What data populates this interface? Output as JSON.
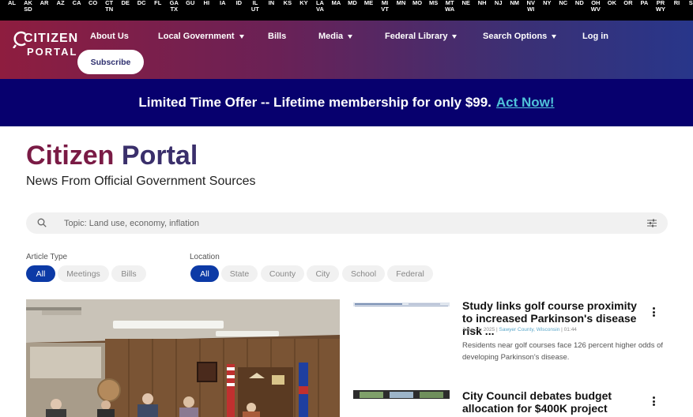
{
  "states": [
    {
      "top": "AL"
    },
    {
      "top": "AK",
      "bottom": "SD"
    },
    {
      "top": "AR"
    },
    {
      "top": "AZ"
    },
    {
      "top": "CA"
    },
    {
      "top": "CO"
    },
    {
      "top": "CT",
      "bottom": "TN"
    },
    {
      "top": "DE"
    },
    {
      "top": "DC"
    },
    {
      "top": "FL"
    },
    {
      "top": "GA",
      "bottom": "TX"
    },
    {
      "top": "GU"
    },
    {
      "top": "HI"
    },
    {
      "top": "IA"
    },
    {
      "top": "ID"
    },
    {
      "top": "IL",
      "bottom": "UT"
    },
    {
      "top": "IN"
    },
    {
      "top": "KS"
    },
    {
      "top": "KY"
    },
    {
      "top": "LA",
      "bottom": "VA"
    },
    {
      "top": "MA"
    },
    {
      "top": "MD"
    },
    {
      "top": "ME"
    },
    {
      "top": "MI",
      "bottom": "VT"
    },
    {
      "top": "MN"
    },
    {
      "top": "MO"
    },
    {
      "top": "MS"
    },
    {
      "top": "MT",
      "bottom": "WA"
    },
    {
      "top": "NE"
    },
    {
      "top": "NH"
    },
    {
      "top": "NJ"
    },
    {
      "top": "NM"
    },
    {
      "top": "NV",
      "bottom": "WI"
    },
    {
      "top": "NY"
    },
    {
      "top": "NC"
    },
    {
      "top": "ND"
    },
    {
      "top": "OH",
      "bottom": "WV"
    },
    {
      "top": "OK"
    },
    {
      "top": "OR"
    },
    {
      "top": "PA"
    },
    {
      "top": "PR",
      "bottom": "WY"
    },
    {
      "top": "RI"
    },
    {
      "top": "SC"
    }
  ],
  "logo": {
    "top": "CITIZEN",
    "bottom": "PORTAL"
  },
  "nav": {
    "about": "About Us",
    "local_gov": "Local Government",
    "bills": "Bills",
    "media": "Media",
    "federal_library": "Federal Library",
    "search_options": "Search Options",
    "login": "Log in",
    "subscribe": "Subscribe"
  },
  "offer": {
    "text": "Limited Time Offer -- Lifetime membership for only $99.",
    "link": "Act Now!"
  },
  "header": {
    "title_a": "Citizen",
    "title_b": "Portal",
    "tagline": "News From Official Government Sources"
  },
  "search": {
    "placeholder": "Topic: Land use, economy, inflation"
  },
  "filters": {
    "article_type": {
      "label": "Article Type",
      "options": [
        "All",
        "Meetings",
        "Bills"
      ],
      "selected": "All"
    },
    "location": {
      "label": "Location",
      "options": [
        "All",
        "State",
        "County",
        "City",
        "School",
        "Federal"
      ],
      "selected": "All"
    }
  },
  "articles": [
    {
      "title": "Study links golf course proximity to increased Parkinson's disease risk ...",
      "date": "June 21, 2025",
      "location": "Sawyer County, Wisconsin",
      "duration": "01:44",
      "description": "Residents near golf courses face 126 percent higher odds of developing Parkinson's disease."
    },
    {
      "title": "City Council debates budget allocation for $400K project funding"
    }
  ],
  "colors": {
    "nav_start": "#8e1d3f",
    "nav_end": "#28368a",
    "banner": "#07006e",
    "link": "#4fc3d9",
    "pill_active": "#0c3aa6",
    "title_red": "#7a1b45",
    "title_purple": "#3a2f6b"
  }
}
